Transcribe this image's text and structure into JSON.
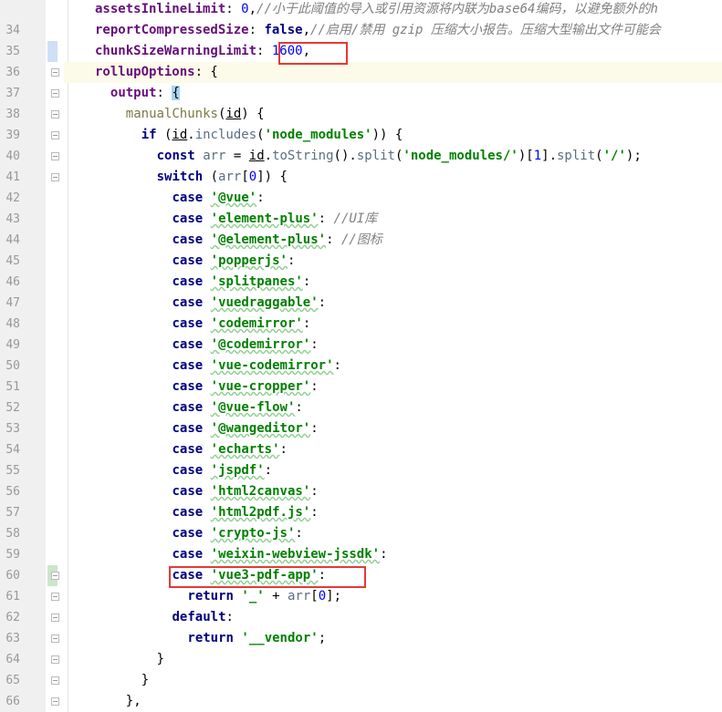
{
  "editor": {
    "line_numbers": [
      "34",
      "35",
      "36",
      "37",
      "38",
      "39",
      "40",
      "41",
      "42",
      "43",
      "44",
      "45",
      "46",
      "47",
      "48",
      "49",
      "50",
      "51",
      "52",
      "53",
      "54",
      "55",
      "56",
      "57",
      "58",
      "59",
      "60",
      "61",
      "62",
      "63",
      "64",
      "65",
      "66"
    ],
    "lines": {
      "l33": {
        "key": "assetsInlineLimit",
        "colon": ": ",
        "value": "0",
        "comma": ",",
        "comment": "//小于此阈值的导入或引用资源将内联为base64编码，以避免额外的h"
      },
      "l34": {
        "key": "reportCompressedSize",
        "colon": ": ",
        "value": "false",
        "comma": ",",
        "comment": "//启用/禁用 gzip 压缩大小报告。压缩大型输出文件可能会"
      },
      "l35": {
        "key": "chunkSizeWarningLimit",
        "colon": ": ",
        "value": "1600",
        "comma": ","
      },
      "l36": {
        "key": "rollupOptions",
        "rest": ": {"
      },
      "l37": {
        "key": "output",
        "colon": ": ",
        "brace": "{"
      },
      "l38": {
        "fn": "manualChunks",
        "open": "(",
        "arg": "id",
        "close": ") {"
      },
      "l39": {
        "kw": "if",
        "p1": " (",
        "id": "id",
        "p2": ".",
        "call": "includes",
        "p3": "(",
        "str": "'node_modules'",
        "p4": ")) {"
      },
      "l40": {
        "kw": "const",
        "p1": " ",
        "var": "arr",
        "p2": " = ",
        "id": "id",
        "p3": ".",
        "c1": "toString",
        "p4": "().",
        "c2": "split",
        "p5": "(",
        "str": "'node_modules/'",
        "p6": ")[",
        "num": "1",
        "p7": "].",
        "c3": "split",
        "p8": "(",
        "str2": "'/'",
        "p9": ");"
      },
      "l41": {
        "kw": "switch",
        "p1": " (",
        "var": "arr",
        "p2": "[",
        "num": "0",
        "p3": "]) {"
      },
      "l63": {
        "kw": "return",
        "p1": " ",
        "str": "'__vendor'",
        "p2": ";"
      },
      "l64": {
        "text": "}"
      },
      "l65": {
        "text": "}"
      },
      "l66": {
        "text": "},"
      },
      "l61": {
        "kw": "return",
        "p1": " ",
        "str": "'_'",
        "p2": " + ",
        "var": "arr",
        "p3": "[",
        "num": "0",
        "p4": "];"
      },
      "l62": {
        "kw": "default",
        "p1": ":"
      }
    },
    "case_keyword": "case",
    "cases": [
      {
        "name": "'@vue'",
        "suffix": ":"
      },
      {
        "name": "'element-plus'",
        "suffix": ": ",
        "comment": "//UI库"
      },
      {
        "name": "'@element-plus'",
        "suffix": ": ",
        "comment": "//图标"
      },
      {
        "name": "'popperjs'",
        "suffix": ":"
      },
      {
        "name": "'splitpanes'",
        "suffix": ":"
      },
      {
        "name": "'vuedraggable'",
        "suffix": ":"
      },
      {
        "name": "'codemirror'",
        "suffix": ":"
      },
      {
        "name": "'@codemirror'",
        "suffix": ":"
      },
      {
        "name": "'vue-codemirror'",
        "suffix": ":"
      },
      {
        "name": "'vue-cropper'",
        "suffix": ":"
      },
      {
        "name": "'@vue-flow'",
        "suffix": ":"
      },
      {
        "name": "'@wangeditor'",
        "suffix": ":"
      },
      {
        "name": "'echarts'",
        "suffix": ":"
      },
      {
        "name": "'jspdf'",
        "suffix": ":"
      },
      {
        "name": "'html2canvas'",
        "suffix": ":"
      },
      {
        "name": "'html2pdf.js'",
        "suffix": ":"
      },
      {
        "name": "'crypto-js'",
        "suffix": ":"
      },
      {
        "name": "'weixin-webview-jssdk'",
        "suffix": ":"
      },
      {
        "name": "'vue3-pdf-app'",
        "suffix": ":"
      }
    ]
  },
  "colors": {
    "highlight_box": "#e53935",
    "keyword": "#000080",
    "string": "#008000",
    "number": "#0000ff",
    "comment": "#808080"
  }
}
